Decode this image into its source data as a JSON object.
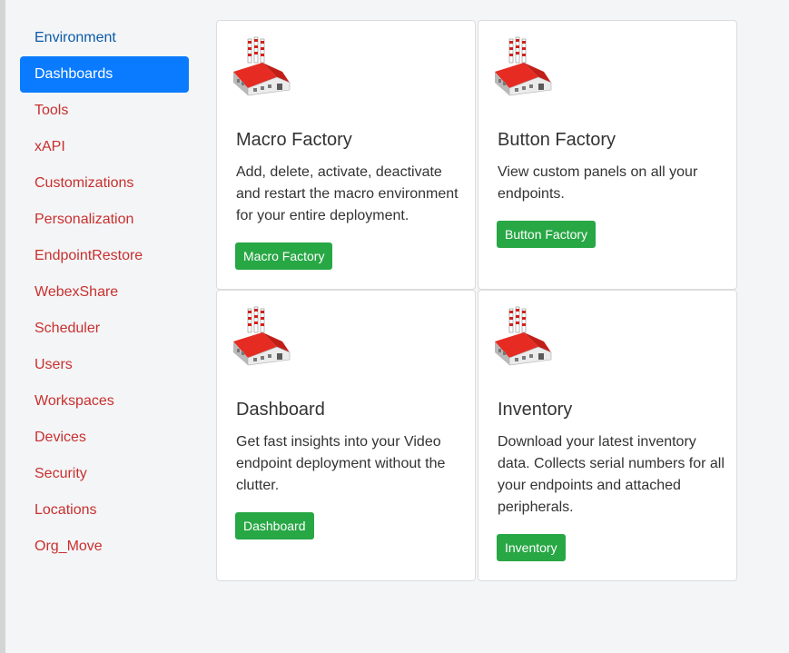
{
  "sidebar": {
    "items": [
      {
        "label": "Environment"
      },
      {
        "label": "Dashboards"
      },
      {
        "label": "Tools"
      },
      {
        "label": "xAPI"
      },
      {
        "label": "Customizations"
      },
      {
        "label": "Personalization"
      },
      {
        "label": "EndpointRestore"
      },
      {
        "label": "WebexShare"
      },
      {
        "label": "Scheduler"
      },
      {
        "label": "Users"
      },
      {
        "label": "Workspaces"
      },
      {
        "label": "Devices"
      },
      {
        "label": "Security"
      },
      {
        "label": "Locations"
      },
      {
        "label": "Org_Move"
      }
    ]
  },
  "cards": [
    {
      "icon": "factory-icon",
      "title": "Macro Factory",
      "description": "Add, delete, activate, deactivate and restart the macro environment for your entire deployment.",
      "button": "Macro Factory"
    },
    {
      "icon": "factory-icon",
      "title": "Button Factory",
      "description": "View custom panels on all your endpoints.",
      "button": "Button Factory"
    },
    {
      "icon": "factory-icon",
      "title": "Dashboard",
      "description": "Get fast insights into your Video endpoint deployment without the clutter.",
      "button": "Dashboard"
    },
    {
      "icon": "factory-icon",
      "title": "Inventory",
      "description": "Download your latest inventory data. Collects serial numbers for all your endpoints and attached peripherals.",
      "button": "Inventory"
    }
  ],
  "colors": {
    "active_nav": "#0a7bff",
    "nav_link": "#c8302e",
    "environment_link": "#0b5aa8",
    "button_green": "#28a745"
  }
}
